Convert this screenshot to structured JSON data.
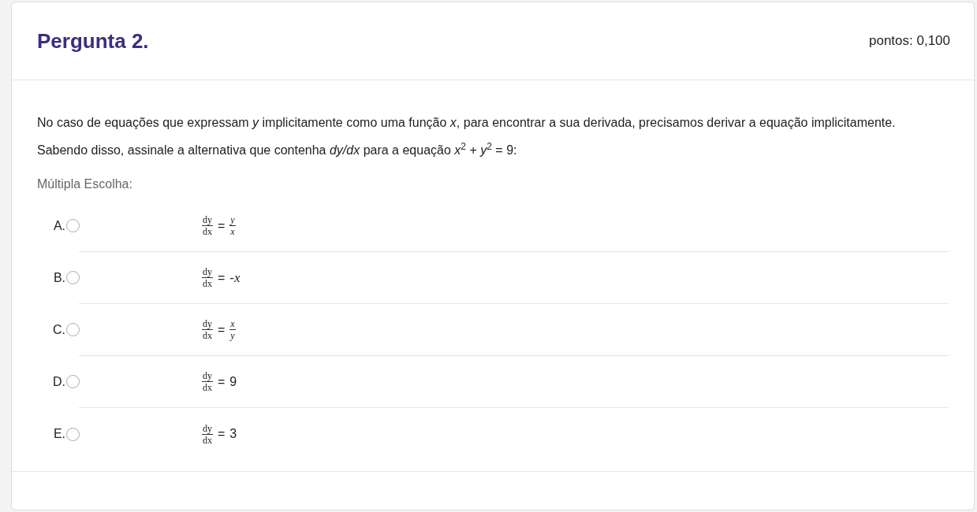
{
  "question": {
    "title": "Pergunta 2.",
    "points": "pontos: 0,100"
  },
  "text": "No caso de equações que expressam *y* implicitamente como uma função *x*, para encontrar a sua derivada, precisamos derivar a equação implicitamente. Sabendo disso, assinale a alternativa que contenha *dy/dx* para a equação *x*$^{2}$ + *y*$^{2}$ = 9:",
  "answer_type": "Múltipla Escolha:",
  "options": [
    {
      "label": "A.",
      "selected": false,
      "numerator": "dy",
      "denominator": "dx",
      "equals": "=",
      "rhs": {
        "kind": "fraction",
        "numerator": "y",
        "denominator": "x"
      }
    },
    {
      "label": "B.",
      "selected": false,
      "numerator": "dy",
      "denominator": "dx",
      "equals": "=",
      "rhs": {
        "kind": "text",
        "text": "-x"
      }
    },
    {
      "label": "C.",
      "selected": false,
      "numerator": "dy",
      "denominator": "dx",
      "equals": "=",
      "rhs": {
        "kind": "fraction",
        "numerator": "x",
        "denominator": "y"
      }
    },
    {
      "label": "D.",
      "selected": false,
      "numerator": "dy",
      "denominator": "dx",
      "equals": "=",
      "rhs": {
        "kind": "number",
        "text": "9"
      }
    },
    {
      "label": "E.",
      "selected": false,
      "numerator": "dy",
      "denominator": "dx",
      "equals": "=",
      "rhs": {
        "kind": "number",
        "text": "3"
      }
    }
  ]
}
